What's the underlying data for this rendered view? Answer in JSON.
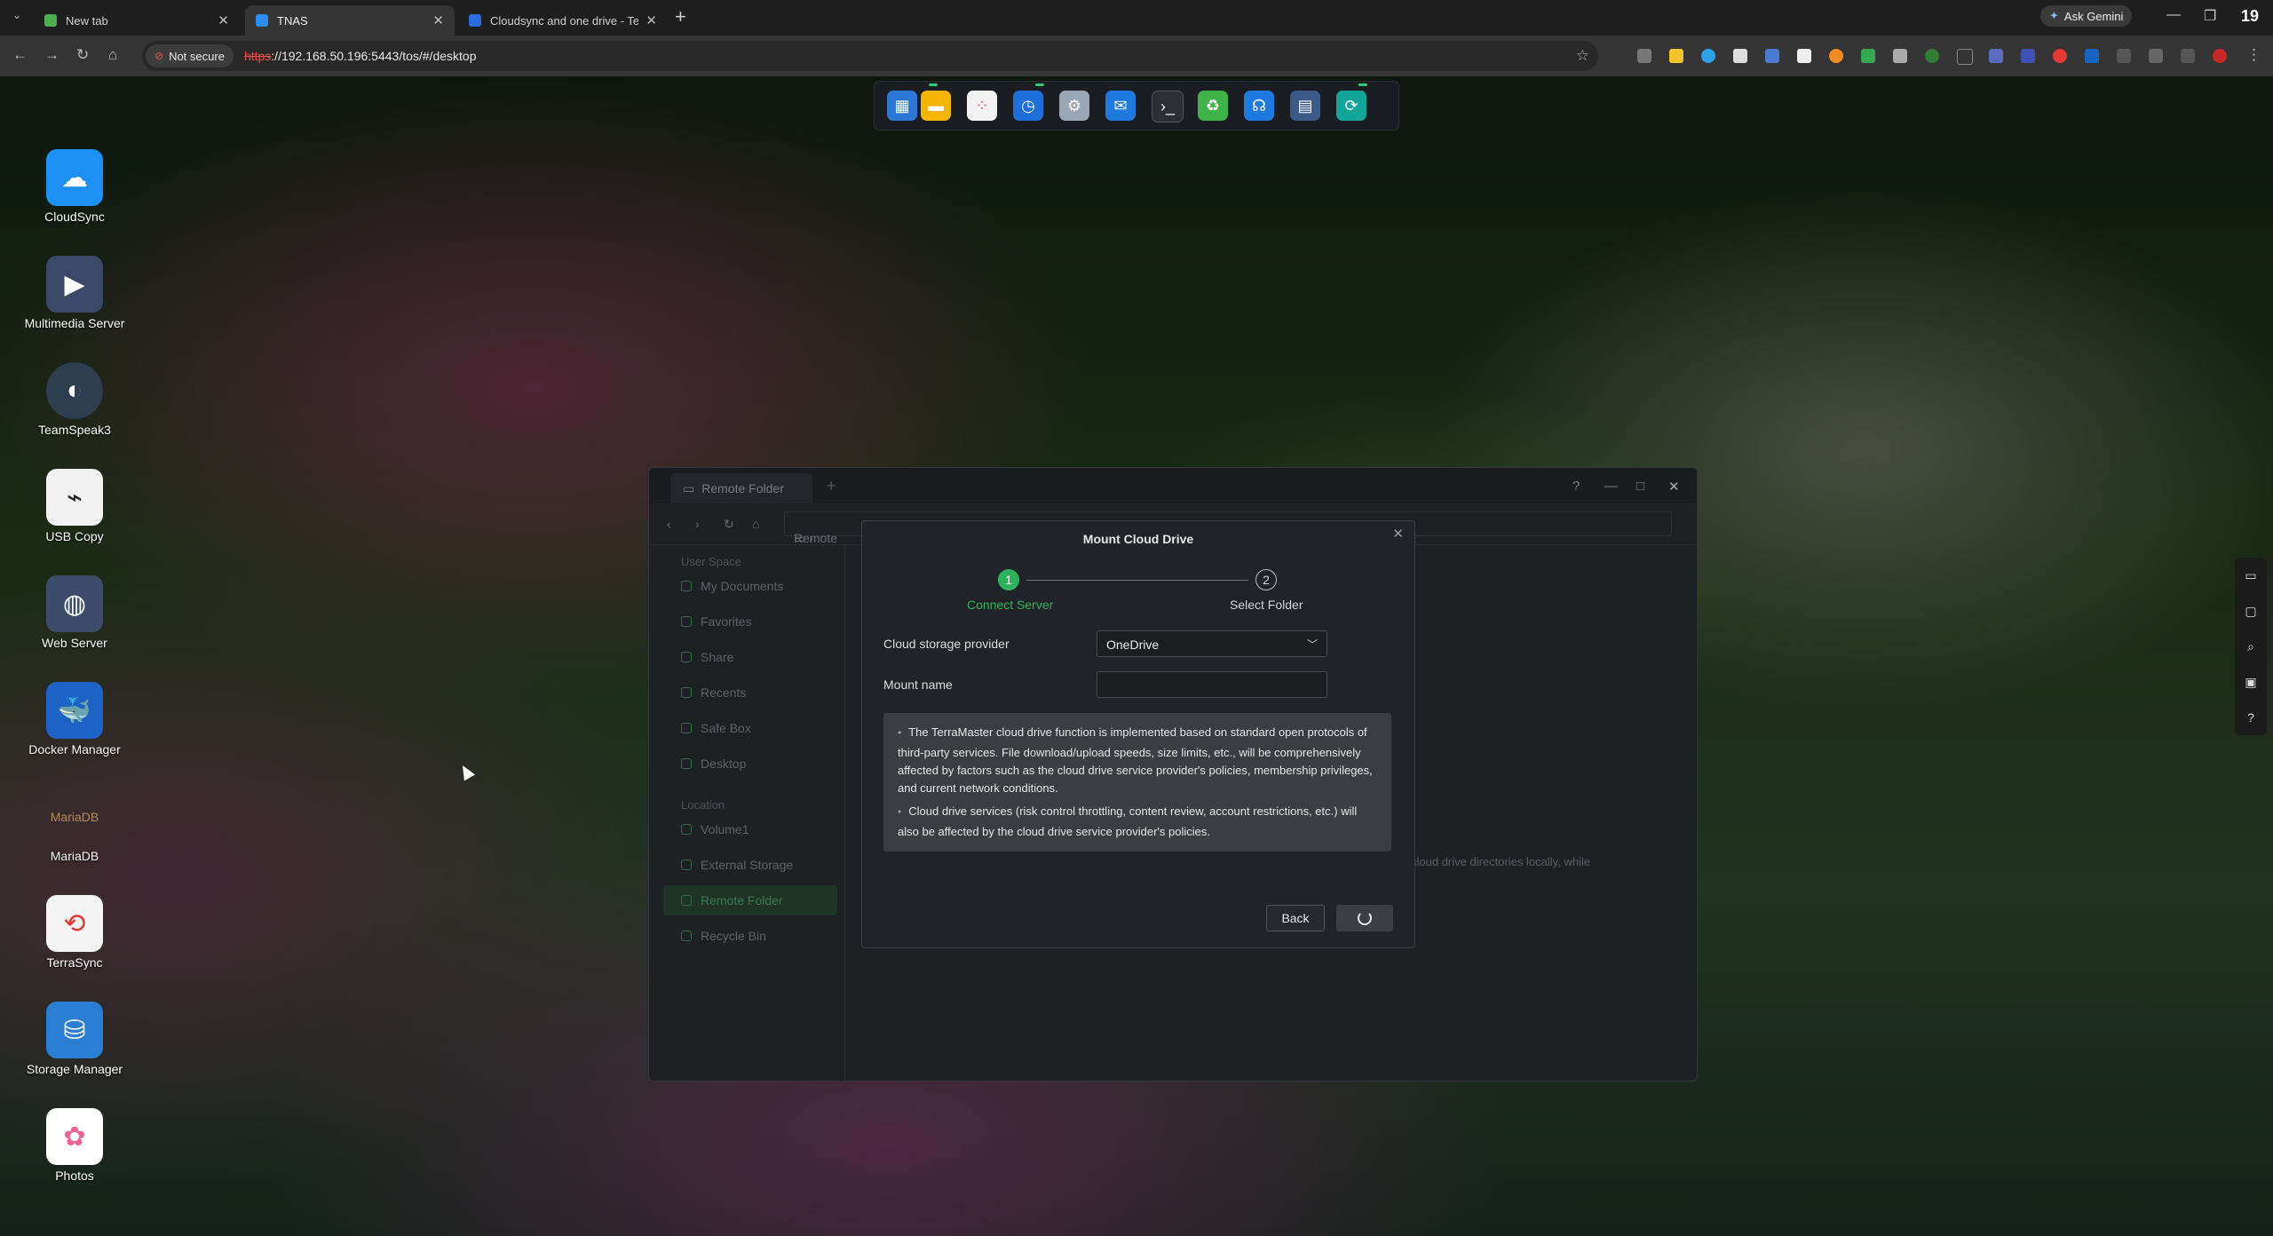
{
  "browser": {
    "tabs": [
      {
        "label": "New tab",
        "favicon_color": "#4caf50"
      },
      {
        "label": "TNAS",
        "favicon_color": "#2d8cf0"
      },
      {
        "label": "Cloudsync and one drive - Terra",
        "favicon_color": "#2d6cdf"
      }
    ],
    "ask_gemini": "Ask Gemini",
    "not_secure": "Not secure",
    "url_protocol": "https",
    "url_rest": "://192.168.50.196:5443/tos/#/desktop",
    "corner_number": "19"
  },
  "dock": {
    "icons": [
      "control-panel-icon",
      "file-manager-icon",
      "app-center-icon",
      "time-machine-icon",
      "settings-icon",
      "mail-icon",
      "terminal-icon",
      "recycle-icon",
      "headset-icon",
      "storage-icon",
      "sync-icon"
    ]
  },
  "desktop": {
    "apps": [
      {
        "label": "CloudSync",
        "icon": "cloudsync-icon",
        "color": "#1e8ff5"
      },
      {
        "label": "Multimedia Server",
        "icon": "multimedia-server-icon",
        "color": "#3a4a66"
      },
      {
        "label": "TeamSpeak3",
        "icon": "teamspeak-icon",
        "color": "#2c3e50"
      },
      {
        "label": "USB Copy",
        "icon": "usb-copy-icon",
        "color": "#f2f2f2"
      },
      {
        "label": "Web Server",
        "icon": "web-server-icon",
        "color": "#3b4d6b"
      },
      {
        "label": "Docker Manager",
        "icon": "docker-icon",
        "color": "#1d63c6"
      },
      {
        "label": "MariaDB",
        "icon": "mariadb-icon",
        "color": "transparent"
      },
      {
        "label": "TerraSync",
        "icon": "terrasync-icon",
        "color": "#f4f4f4"
      },
      {
        "label": "Storage Manager",
        "icon": "storage-manager-icon",
        "color": "#2a7fd4"
      },
      {
        "label": "Photos",
        "icon": "photos-icon",
        "color": "#ffffff"
      }
    ]
  },
  "file_manager": {
    "tab_label": "Remote Folder",
    "path": "Remote",
    "sections": {
      "user_space": "User Space",
      "location": "Location"
    },
    "user_space_items": [
      "My Documents",
      "Favorites",
      "Share",
      "Recents",
      "Safe Box",
      "Desktop"
    ],
    "location_items": [
      "Volume1",
      "External Storage",
      "Remote Folder",
      "Recycle Bin"
    ],
    "hint_fragment": "cloud drive directories locally, while"
  },
  "modal": {
    "title": "Mount Cloud Drive",
    "step1_number": "1",
    "step1_label": "Connect Server",
    "step2_number": "2",
    "step2_label": "Select Folder",
    "provider_label": "Cloud storage provider",
    "provider_value": "OneDrive",
    "mount_name_label": "Mount name",
    "mount_name_value": "",
    "notice_1": "The TerraMaster cloud drive function is implemented based on standard open protocols of third-party services. File download/upload speeds, size limits, etc., will be comprehensively affected by factors such as the cloud drive service provider's policies, membership privileges, and current network conditions.",
    "notice_2": "Cloud drive services (risk control throttling, content review, account restrictions, etc.) will also be affected by the cloud drive service provider's policies.",
    "back_label": "Back",
    "accent_color": "#2db35d"
  }
}
